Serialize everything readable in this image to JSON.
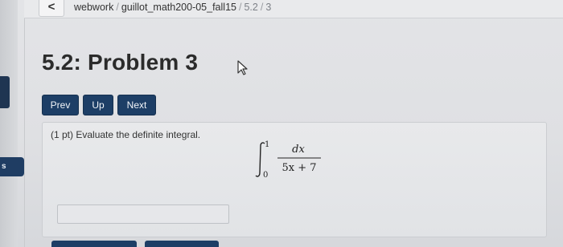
{
  "breadcrumb": {
    "back_label": "<",
    "parts": [
      "webwork",
      "guillot_math200-05_fall15",
      "5.2",
      "3"
    ],
    "separator": "/"
  },
  "sidebar": {
    "badge_label": "s"
  },
  "problem": {
    "title": "5.2: Problem 3",
    "points": "(1 pt)",
    "statement": "Evaluate the definite integral.",
    "integral": {
      "lower_limit": "0",
      "upper_limit": "1",
      "numerator": "dx",
      "denominator": "5x + 7"
    },
    "answer_value": "",
    "answer_placeholder": ""
  },
  "nav": {
    "prev_label": "Prev",
    "up_label": "Up",
    "next_label": "Next"
  },
  "colors": {
    "button_bg": "#1d3e66",
    "page_bg": "#dfe0e4",
    "text": "#2b2b2b"
  }
}
